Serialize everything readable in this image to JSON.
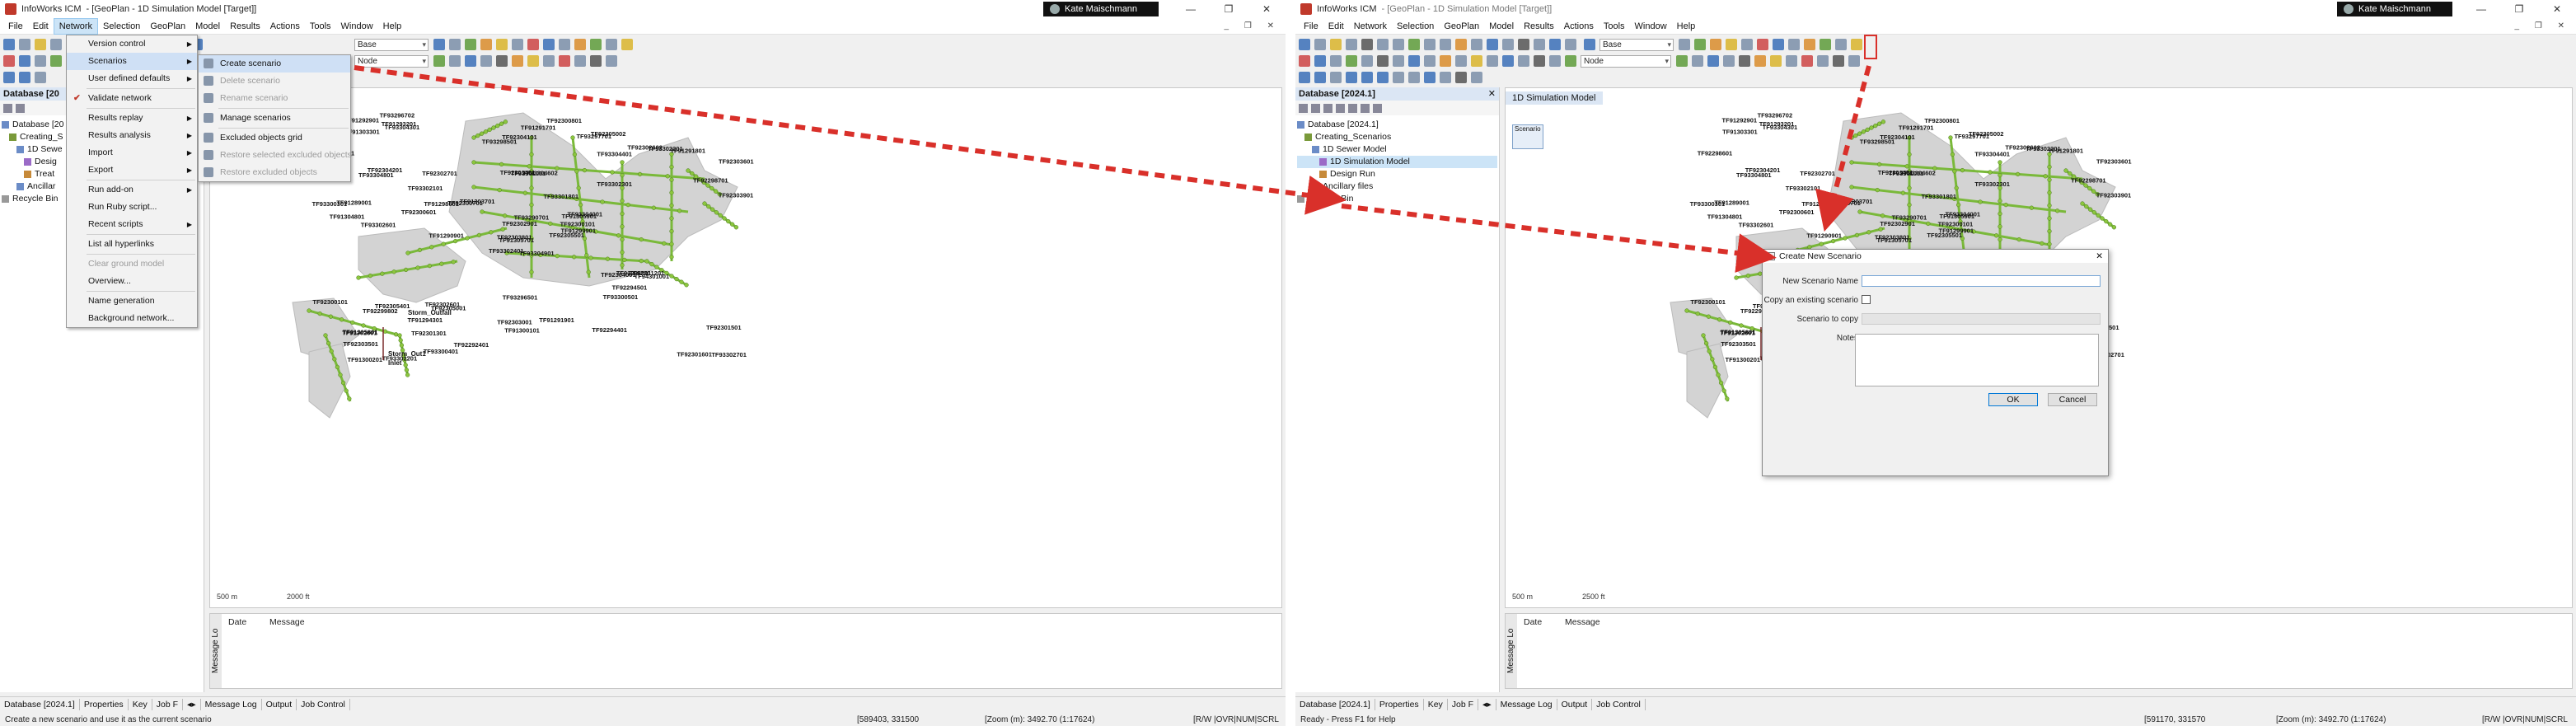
{
  "left": {
    "title": "InfoWorks ICM",
    "title_doc": "- [GeoPlan - 1D Simulation Model [Target]]",
    "user": "Kate Maischmann",
    "menus": [
      "File",
      "Edit",
      "Network",
      "Selection",
      "GeoPlan",
      "Model",
      "Results",
      "Actions",
      "Tools",
      "Window",
      "Help"
    ],
    "network_menu": [
      {
        "label": "Version control",
        "arrow": true
      },
      {
        "label": "Scenarios",
        "arrow": true,
        "highlight": true
      },
      {
        "label": "User defined defaults",
        "arrow": true
      },
      {
        "label": "Validate network",
        "check": true
      },
      {
        "label": "Results replay",
        "arrow": true
      },
      {
        "label": "Results analysis",
        "arrow": true
      },
      {
        "label": "Import",
        "arrow": true
      },
      {
        "label": "Export",
        "arrow": true
      },
      {
        "label": "Run add-on",
        "arrow": true
      },
      {
        "label": "Run Ruby script..."
      },
      {
        "label": "Recent scripts",
        "arrow": true
      },
      {
        "label": "List all hyperlinks"
      },
      {
        "label": "Clear ground model",
        "disabled": true
      },
      {
        "label": "Overview..."
      },
      {
        "label": "Name generation"
      },
      {
        "label": "Background network..."
      }
    ],
    "scenarios_menu": [
      {
        "label": "Create scenario",
        "highlight": true
      },
      {
        "label": "Delete scenario",
        "disabled": true
      },
      {
        "label": "Rename scenario",
        "disabled": true
      },
      {
        "label": "Manage scenarios"
      },
      {
        "label": "Excluded objects grid"
      },
      {
        "label": "Restore selected excluded objects",
        "disabled": true
      },
      {
        "label": "Restore excluded objects",
        "disabled": true
      }
    ],
    "explorer_title": "Database [20",
    "tree": [
      "Database [20",
      "Creating_S",
      "1D Sewe",
      "Desig",
      "Treat",
      "Ancillar",
      "Recycle Bin"
    ],
    "scale_left": "500 m",
    "scale_right": "2000 ft",
    "combo_base": "Base",
    "combo_node": "Node",
    "msg_vtab": "Message Lo",
    "msg_date": "Date",
    "msg_message": "Message",
    "bottom_tabs": [
      "Database [2024.1]",
      "Properties",
      "Key",
      "Job F"
    ],
    "bottom_tabs2": [
      "Message Log",
      "Output",
      "Job Control"
    ],
    "status_text": "Create a new scenario and use it as the current scenario",
    "status_coords": "[589403, 331500",
    "status_zoom": "[Zoom (m): 3492.70 (1:17624)",
    "status_flags": "[R/W  |OVR|NUM|SCRL"
  },
  "right": {
    "title": "InfoWorks ICM",
    "title_doc": "- [GeoPlan - 1D Simulation Model [Target]]",
    "user": "Kate Maischmann",
    "menus": [
      "File",
      "Edit",
      "Network",
      "Selection",
      "GeoPlan",
      "Model",
      "Results",
      "Actions",
      "Tools",
      "Window",
      "Help"
    ],
    "explorer_title": "Database [2024.1]",
    "view_tab": "1D Simulation Model",
    "thumb_label": "Scenario",
    "tree": [
      "Database [2024.1]",
      "Creating_Scenarios",
      "1D Sewer Model",
      "1D Simulation Model",
      "Design Run",
      "Ancillary files",
      "Recycle Bin"
    ],
    "dialog": {
      "title": "Create New Scenario",
      "name_label": "New Scenario Name",
      "copy_label": "Copy an existing scenario",
      "scenario_label": "Scenario to copy",
      "notes_label": "Notes",
      "ok": "OK",
      "cancel": "Cancel"
    },
    "scale_left": "500 m",
    "scale_right": "2500 ft",
    "combo_base": "Base",
    "combo_node": "Node",
    "msg_vtab": "Message Lo",
    "msg_date": "Date",
    "msg_message": "Message",
    "bottom_tabs": [
      "Database [2024.1]",
      "Properties",
      "Key",
      "Job F"
    ],
    "bottom_tabs2": [
      "Message Log",
      "Output",
      "Job Control"
    ],
    "status_text": "Ready - Press F1 for Help",
    "status_coords": "[591170, 331570",
    "status_zoom": "[Zoom (m): 3492.70 (1:17624)",
    "status_flags": "[R/W  |OVR|NUM|SCRL"
  },
  "map_labels": [
    "TF93304901",
    "TF93304801",
    "TF91305701",
    "TF91305801",
    "TF91305901",
    "TF92305001",
    "TF92305002",
    "TF93304602",
    "TF93304401",
    "TF92305501",
    "TF93304301",
    "TF93302701",
    "TF93302601",
    "TF92303601",
    "TF93302401",
    "TF93302301",
    "TF93302201",
    "TF92301401",
    "TF93301801",
    "TF92305401",
    "TF91303701",
    "TF92303501",
    "TF92301301",
    "TF93301001",
    "TF93304001",
    "TF94301001",
    "TF92304201",
    "TF92304101",
    "TF91304801",
    "TF92304001",
    "TF92303901",
    "TF92303801",
    "TF92303001",
    "TF92302901",
    "TF92302701",
    "TF92302602",
    "TF92302601",
    "TF92301601",
    "TF92301501",
    "TF92301201",
    "TF92300801",
    "TF92300701",
    "TF92300601",
    "TF93300501",
    "TF93300401",
    "TF93300301",
    "TF92300101",
    "TF91300201",
    "TF91300101",
    "TF91299901",
    "TF92299802",
    "TF92298701",
    "TF92298601",
    "TF92294501",
    "TF92294401",
    "TF91294301",
    "TF91293201",
    "TF91292901",
    "TF91291901",
    "TF91291801",
    "TF91291701",
    "TF91290901",
    "TF91289001",
    "TF93302101",
    "TF93302201",
    "TF93296702",
    "TF93297701",
    "TF93298501",
    "TF93290701",
    "TF92300101",
    "TF93296501",
    "TF92292401",
    "TF91296801",
    "TF91298601",
    "TF91302801",
    "TF91303301"
  ],
  "outfall_label": "Storm_Outfall",
  "storm_label": "Storm_Out1",
  "inlet_label": "Inlet",
  "colors": {
    "network": "#7ab93a",
    "node": "#8cc63f",
    "catchment": "#d3d3d3",
    "arrow": "#d9302a",
    "accent": "#0078d7"
  }
}
